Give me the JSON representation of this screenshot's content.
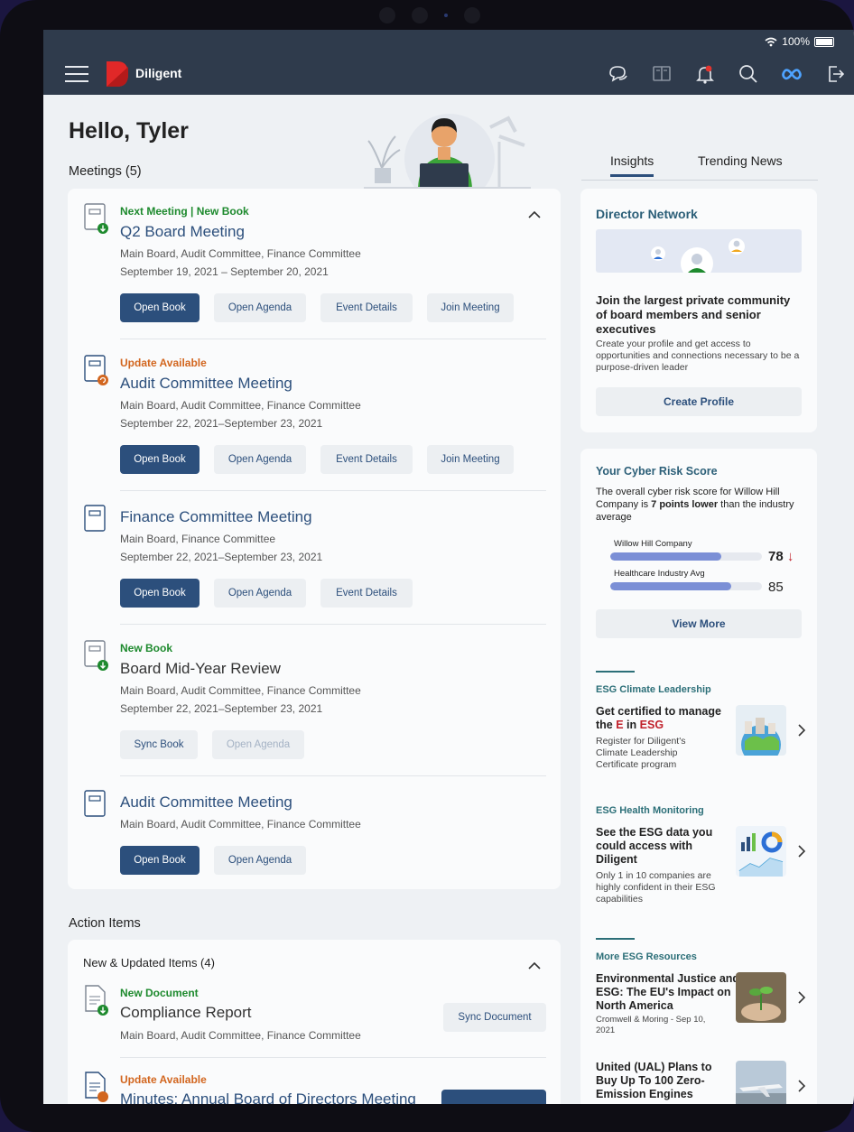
{
  "status": {
    "battery": "100%"
  },
  "app": {
    "brand": "Diligent"
  },
  "greeting": "Hello, Tyler",
  "meetings": {
    "heading": "Meetings (5)",
    "items": [
      {
        "tag": "Next Meeting | New Book",
        "title": "Q2 Board Meeting",
        "groups": "Main Board, Audit Committee, Finance Committee",
        "dates": "September 19, 2021 – September 20, 2021",
        "buttons": [
          "Open Book",
          "Open Agenda",
          "Event Details",
          "Join Meeting"
        ]
      },
      {
        "tag": "Update Available",
        "title": "Audit Committee Meeting",
        "groups": "Main Board, Audit Committee, Finance Committee",
        "dates": "September 22, 2021–September 23, 2021",
        "buttons": [
          "Open Book",
          "Open Agenda",
          "Event Details",
          "Join Meeting"
        ]
      },
      {
        "title": "Finance Committee Meeting",
        "groups": "Main Board, Finance Committee",
        "dates": "September 22, 2021–September 23, 2021",
        "buttons": [
          "Open Book",
          "Open Agenda",
          "Event Details"
        ]
      },
      {
        "tag": "New Book",
        "title": "Board Mid-Year Review",
        "groups": "Main Board, Audit Committee, Finance Committee",
        "dates": "September 22, 2021–September 23, 2021",
        "buttons": [
          "Sync Book",
          "Open Agenda"
        ]
      },
      {
        "title": "Audit Committee Meeting",
        "groups": "Main Board, Audit Committee, Finance Committee",
        "buttons": [
          "Open Book",
          "Open Agenda"
        ]
      }
    ]
  },
  "actions": {
    "heading": "Action Items",
    "subheading": "New & Updated Items (4)",
    "items": [
      {
        "tag": "New Document",
        "title": "Compliance Report",
        "groups": "Main Board, Audit Committee, Finance Committee",
        "button": "Sync Document"
      },
      {
        "tag": "Update Available",
        "title": "Minutes: Annual Board of Directors Meeting"
      }
    ]
  },
  "tabs": [
    "Insights",
    "Trending News"
  ],
  "director": {
    "title": "Director Network",
    "headline": "Join the largest private community of board members and senior executives",
    "body": "Create your profile and get access to opportunities and connections necessary to be a purpose-driven leader",
    "button": "Create Profile"
  },
  "cyber": {
    "title": "Your Cyber Risk Score",
    "text_a": "The overall cyber risk score for Willow Hill Company is ",
    "text_bold": "7 points lower",
    "text_b": " than the industry average",
    "bars": [
      {
        "label": "Willow Hill Company",
        "value": 78,
        "fill": 0.73
      },
      {
        "label": "Healthcare Industry Avg",
        "value": 85,
        "fill": 0.8
      }
    ],
    "button": "View More"
  },
  "esg": [
    {
      "category": "ESG Climate Leadership",
      "headline_a": "Get certified to manage the ",
      "headline_e": "E",
      "headline_in": " in ",
      "headline_esg": "ESG",
      "body": "Register for Diligent's Climate Leadership Certificate program"
    },
    {
      "category": "ESG Health Monitoring",
      "headline": "See the ESG data you could access with Diligent",
      "body": "Only 1 in 10 companies are highly confident in their ESG capabilities"
    },
    {
      "category": "More ESG Resources",
      "headline": "Environmental Justice and ESG: The EU's Impact on North America",
      "body": "Cromwell & Moring - Sep 10, 2021"
    },
    {
      "headline": "United (UAL) Plans to Buy Up To 100 Zero-Emission Engines"
    }
  ],
  "colors": {
    "navy": "#2c4f7c",
    "appbar": "#2f3b4c",
    "green": "#1e8a2e",
    "orange": "#d2661f",
    "teal": "#2c6f78",
    "bar": "#7b8fd6"
  }
}
